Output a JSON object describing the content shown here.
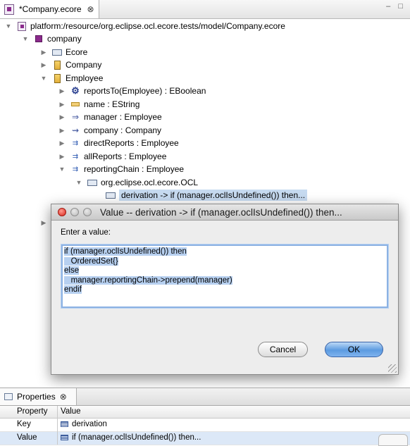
{
  "editor": {
    "tab_title": "*Company.ecore",
    "close_glyph": "⊗",
    "window_controls": "– □"
  },
  "tree": {
    "nodes": [
      {
        "label": "platform:/resource/org.eclipse.ocl.ecore.tests/model/Company.ecore",
        "icon": "resource-icon",
        "expanded": true
      },
      {
        "label": "company",
        "icon": "package-icon",
        "expanded": true
      },
      {
        "label": "Ecore",
        "icon": "annotation-icon",
        "expanded": false
      },
      {
        "label": "Company",
        "icon": "class-icon",
        "expanded": false
      },
      {
        "label": "Employee",
        "icon": "class-icon",
        "expanded": true
      },
      {
        "label": "reportsTo(Employee) : EBoolean",
        "icon": "operation-icon",
        "expanded": false
      },
      {
        "label": "name : EString",
        "icon": "attribute-icon",
        "expanded": false
      },
      {
        "label": "manager : Employee",
        "icon": "reference-icon",
        "expanded": false
      },
      {
        "label": "company : Company",
        "icon": "container-reference-icon",
        "expanded": false
      },
      {
        "label": "directReports : Employee",
        "icon": "many-reference-icon",
        "expanded": false
      },
      {
        "label": "allReports : Employee",
        "icon": "many-reference-icon",
        "expanded": false
      },
      {
        "label": "reportingChain : Employee",
        "icon": "many-reference-icon",
        "expanded": true
      },
      {
        "label": "org.eclipse.ocl.ecore.OCL",
        "icon": "annotation-icon",
        "expanded": true
      },
      {
        "label": "derivation -> if (manager.oclIsUndefined()) then...",
        "icon": "details-entry-icon",
        "selected": true
      }
    ]
  },
  "dialog": {
    "title": "Value -- derivation -> if (manager.oclIsUndefined()) then...",
    "prompt": "Enter a value:",
    "value_lines": [
      "if (manager.oclIsUndefined()) then",
      "   OrderedSet{}",
      "else",
      "   manager.reportingChain->prepend(manager)",
      "endif"
    ],
    "cancel_label": "Cancel",
    "ok_label": "OK"
  },
  "properties": {
    "tab_title": "Properties",
    "close_glyph": "⊗",
    "col_property": "Property",
    "col_value": "Value",
    "rows": [
      {
        "property": "Key",
        "value": "derivation"
      },
      {
        "property": "Value",
        "value": "if (manager.oclIsUndefined()) then..."
      }
    ]
  },
  "colors": {
    "selection": "#c6daf0",
    "dialog_bg": "#ededed",
    "ok_button": "#5c9be0",
    "close_button": "#d9261c"
  }
}
